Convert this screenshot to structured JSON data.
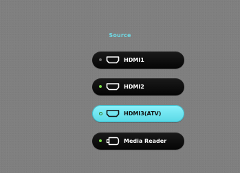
{
  "menu": {
    "title": "Source",
    "items": [
      {
        "label": "HDMI1",
        "icon": "hdmi-port-icon",
        "status": "inactive",
        "selected": false
      },
      {
        "label": "HDMI2",
        "icon": "hdmi-port-icon",
        "status": "signal",
        "selected": false
      },
      {
        "label": "HDMI3(ATV)",
        "icon": "hdmi-port-icon",
        "status": "signal",
        "selected": true
      },
      {
        "label": "Media Reader",
        "icon": "usb-port-icon",
        "status": "signal",
        "selected": false
      }
    ]
  },
  "colors": {
    "title": "#6fdbe6",
    "selected": "#7fe9f4",
    "button": "#0e0e0e",
    "signal_dot": "#7be047"
  }
}
